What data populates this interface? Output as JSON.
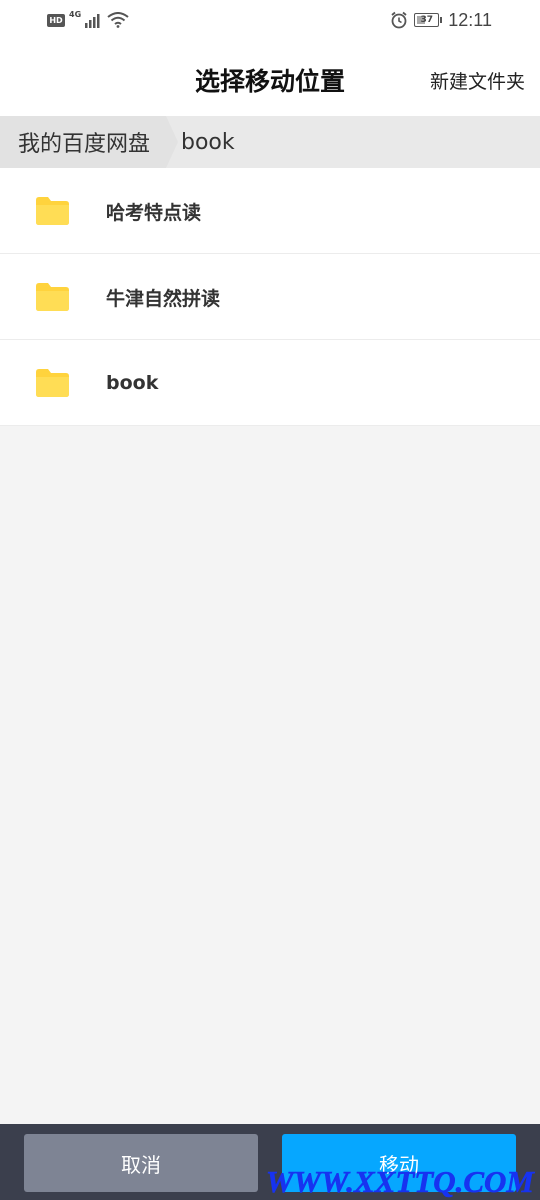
{
  "status_bar": {
    "hd_label": "HD",
    "network_label": "4G",
    "battery_level": "37",
    "time": "12:11",
    "icons": [
      "signal-icon",
      "wifi-icon",
      "alarm-icon",
      "battery-icon"
    ]
  },
  "header": {
    "title": "选择移动位置",
    "new_folder_label": "新建文件夹"
  },
  "breadcrumb": {
    "root": "我的百度网盘",
    "current": "book"
  },
  "folders": [
    {
      "name": "哈考特点读"
    },
    {
      "name": "牛津自然拼读"
    },
    {
      "name": "book"
    }
  ],
  "actions": {
    "cancel_label": "取消",
    "move_label": "移动"
  },
  "watermark": "WWW.XXTTQ.COM",
  "colors": {
    "accent": "#06a7ff",
    "folder": "#ffd33d",
    "bottom_bar": "#3b3f4d",
    "cancel_button": "#7e8494"
  }
}
